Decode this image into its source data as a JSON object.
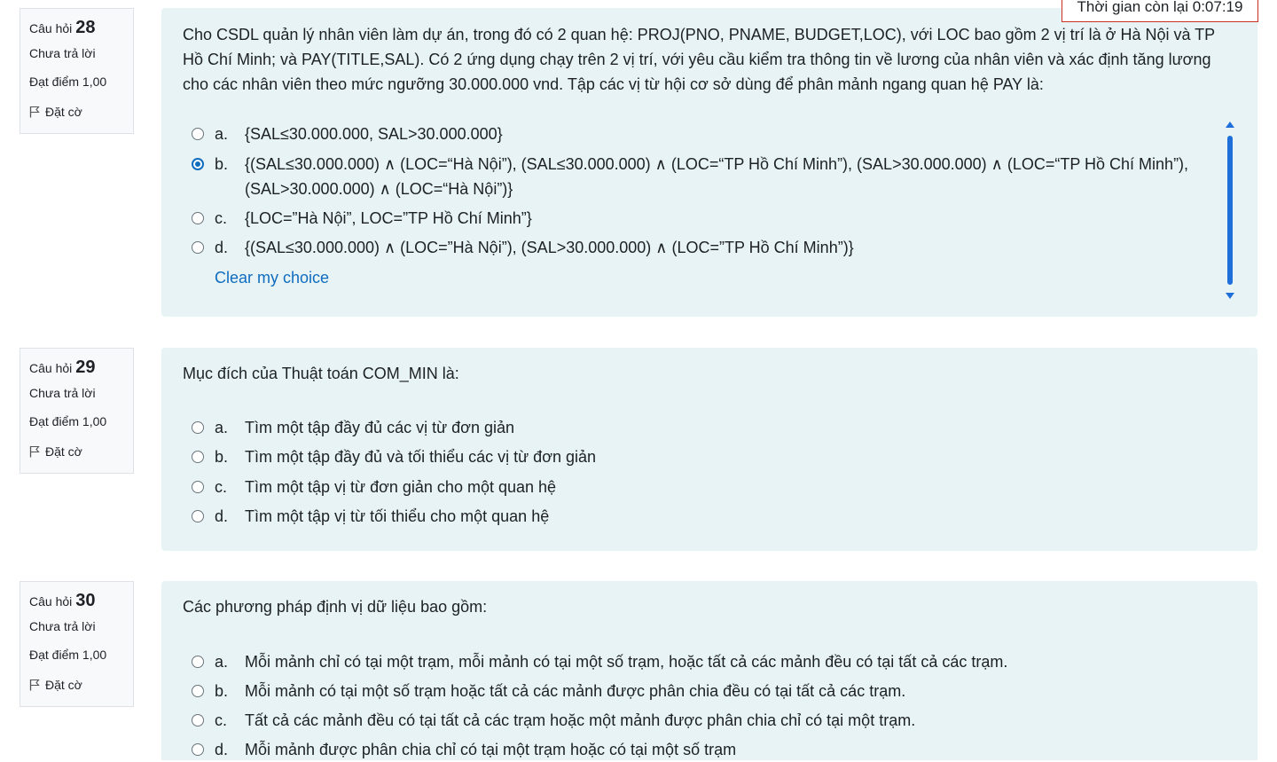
{
  "timer": {
    "text": "Thời gian còn lại 0:07:19"
  },
  "questions": [
    {
      "label": "Câu hỏi",
      "number": "28",
      "state": "Chưa trả lời",
      "grade": "Đạt điểm 1,00",
      "flag": "Đặt cờ",
      "text": "Cho CSDL quản lý nhân viên làm dự án, trong đó có 2 quan hệ: PROJ(PNO, PNAME, BUDGET,LOC), với LOC bao gồm 2 vị trí là ở Hà Nội và TP Hồ Chí Minh; và PAY(TITLE,SAL). Có 2 ứng dụng chạy trên 2 vị trí, với yêu cầu kiểm tra thông tin về lương của nhân viên và xác định tăng lương cho các nhân viên theo mức ngưỡng 30.000.000 vnd. Tập các vị từ hội cơ sở dùng để phân mảnh ngang quan hệ PAY là:",
      "options": [
        {
          "letter": "a.",
          "text": "{SAL≤30.000.000, SAL>30.000.000}",
          "checked": false
        },
        {
          "letter": "b.",
          "text": "{(SAL≤30.000.000) ∧ (LOC=“Hà Nội”), (SAL≤30.000.000) ∧ (LOC=“TP Hồ Chí Minh”), (SAL>30.000.000) ∧ (LOC=“TP Hồ Chí Minh”), (SAL>30.000.000) ∧ (LOC=“Hà Nội”)}",
          "checked": true
        },
        {
          "letter": "c.",
          "text": "{LOC=”Hà Nội”, LOC=”TP Hồ Chí Minh”}",
          "checked": false
        },
        {
          "letter": "d.",
          "text": "{(SAL≤30.000.000) ∧ (LOC=”Hà Nội”), (SAL>30.000.000) ∧ (LOC=”TP Hồ Chí Minh”)}",
          "checked": false
        }
      ],
      "clear_label": "Clear my choice"
    },
    {
      "label": "Câu hỏi",
      "number": "29",
      "state": "Chưa trả lời",
      "grade": "Đạt điểm 1,00",
      "flag": "Đặt cờ",
      "text": "Mục đích của Thuật toán COM_MIN là:",
      "options": [
        {
          "letter": "a.",
          "text": "Tìm một tập đầy đủ các vị từ đơn giản",
          "checked": false
        },
        {
          "letter": "b.",
          "text": "Tìm một tập đầy đủ và tối thiểu các vị từ đơn giản",
          "checked": false
        },
        {
          "letter": "c.",
          "text": "Tìm một tập vị từ đơn giản cho một quan hệ",
          "checked": false
        },
        {
          "letter": "d.",
          "text": "Tìm một tập vị từ tối thiểu cho một quan hệ",
          "checked": false
        }
      ]
    },
    {
      "label": "Câu hỏi",
      "number": "30",
      "state": "Chưa trả lời",
      "grade": "Đạt điểm 1,00",
      "flag": "Đặt cờ",
      "text": "Các phương pháp định vị dữ liệu bao gồm:",
      "options": [
        {
          "letter": "a.",
          "text": "Mỗi mảnh chỉ có tại một trạm, mỗi mảnh có tại một số trạm, hoặc tất cả các mảnh đều có tại tất cả các trạm.",
          "checked": false
        },
        {
          "letter": "b.",
          "text": "Mỗi mảnh có tại một số trạm hoặc tất cả các mảnh được phân chia đều có tại tất cả các trạm.",
          "checked": false
        },
        {
          "letter": "c.",
          "text": "Tất cả các mảnh đều có tại tất cả các trạm hoặc một mảnh được phân chia chỉ có tại một trạm.",
          "checked": false
        },
        {
          "letter": "d.",
          "text": "Mỗi mảnh được phân chia chỉ có tại một trạm hoặc có tại một số trạm",
          "checked": false
        }
      ]
    }
  ]
}
